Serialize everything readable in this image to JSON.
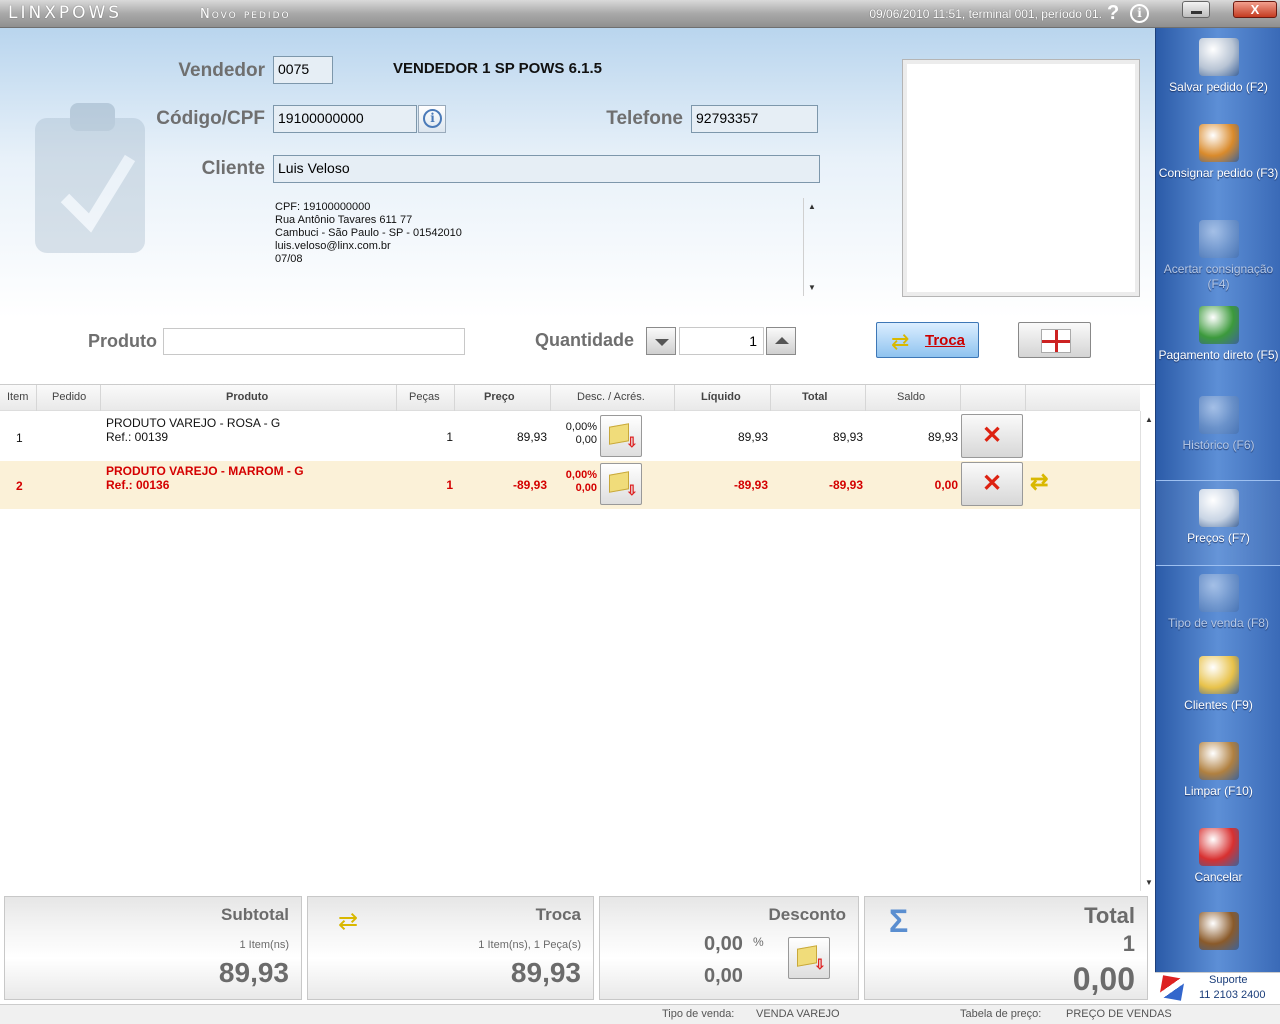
{
  "titlebar": {
    "brand": "LINXPOWS",
    "screen_title": "Novo pedido",
    "status": "09/06/2010 11:51, terminal 001, período 01.",
    "help_icon": "?",
    "close_label": "X"
  },
  "form": {
    "vendedor_label": "Vendedor",
    "vendedor_code": "0075",
    "vendedor_name": "VENDEDOR 1 SP POWS 6.1.5",
    "codigo_label": "Código/CPF",
    "codigo_value": "19100000000",
    "telefone_label": "Telefone",
    "telefone_value": "92793357",
    "cliente_label": "Cliente",
    "cliente_value": "Luis Veloso",
    "address_lines": [
      "CPF: 19100000000",
      "Rua Antônio Tavares 611 77",
      "Cambuci - São Paulo - SP - 01542010",
      "luis.veloso@linx.com.br",
      "07/08"
    ]
  },
  "entry": {
    "produto_label": "Produto",
    "quantidade_label": "Quantidade",
    "quantidade_value": "1",
    "troca_label": "Troca"
  },
  "table": {
    "headers": [
      "Item",
      "Pedido",
      "Produto",
      "Peças",
      "Preço",
      "Desc. / Acrés.",
      "Líquido",
      "Total",
      "Saldo"
    ],
    "rows": [
      {
        "item": "1",
        "pedido": "",
        "produto": "PRODUTO VAREJO - ROSA - G",
        "ref": "Ref.: 00139",
        "pecas": "1",
        "preco": "89,93",
        "desc_pct": "0,00%",
        "desc_val": "0,00",
        "liquido": "89,93",
        "total": "89,93",
        "saldo": "89,93"
      },
      {
        "item": "2",
        "pedido": "",
        "produto": "PRODUTO VAREJO - MARROM - G",
        "ref": "Ref.: 00136",
        "pecas": "1",
        "preco": "-89,93",
        "desc_pct": "0,00%",
        "desc_val": "0,00",
        "liquido": "-89,93",
        "total": "-89,93",
        "saldo": "0,00"
      }
    ]
  },
  "totals": {
    "subtotal_label": "Subtotal",
    "subtotal_sub": "1 Item(ns)",
    "subtotal_value": "89,93",
    "troca_label": "Troca",
    "troca_sub": "1 Item(ns), 1 Peça(s)",
    "troca_value": "89,93",
    "desconto_label": "Desconto",
    "desconto_pct": "0,00",
    "desconto_pct_sign": "%",
    "desconto_value": "0,00",
    "total_label": "Total",
    "total_count": "1",
    "total_value": "0,00",
    "sigma": "Σ"
  },
  "statusbar": {
    "tipo_label": "Tipo de venda:",
    "tipo_value": "VENDA VAREJO",
    "tabela_label": "Tabela de preço:",
    "tabela_value": "PREÇO DE VENDAS"
  },
  "sidebar": {
    "items": [
      {
        "label": "Salvar pedido (F2)",
        "icon": "disc-save-icon",
        "color": "#b8c4d4"
      },
      {
        "label": "Consignar pedido (F3)",
        "icon": "shopping-bag-icon",
        "color": "#d98a2b"
      },
      {
        "label": "Acertar consignação (F4)",
        "icon": "bag-check-icon",
        "color": "#8ea6c8"
      },
      {
        "label": "Pagamento direto (F5)",
        "icon": "money-icon",
        "color": "#3c9a3c"
      },
      {
        "label": "Histórico (F6)",
        "icon": "history-icon",
        "color": "#7f9ac0"
      },
      {
        "label": "Preços (F7)",
        "icon": "magnifier-icon",
        "color": "#c8d4e4"
      },
      {
        "label": "Tipo de venda (F8)",
        "icon": "sale-type-icon",
        "color": "#8ea6c8"
      },
      {
        "label": "Clientes (F9)",
        "icon": "folder-clients-icon",
        "color": "#e8c24a"
      },
      {
        "label": "Limpar (F10)",
        "icon": "broom-icon",
        "color": "#b08040"
      },
      {
        "label": "Cancelar",
        "icon": "cancel-icon",
        "color": "#d83030"
      },
      {
        "label": "",
        "icon": "exit-door-icon",
        "color": "#8a5a2a"
      }
    ],
    "support_title": "Suporte",
    "support_phone": "11 2103 2400"
  }
}
